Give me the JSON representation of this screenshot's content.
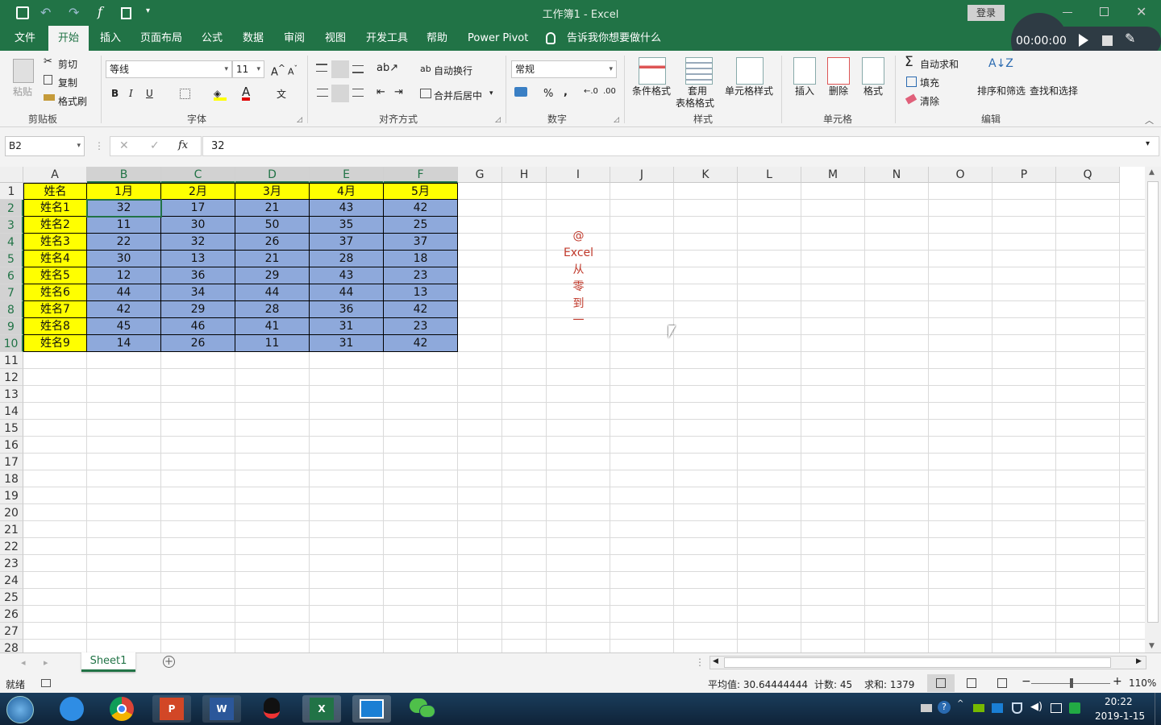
{
  "title": {
    "doc": "工作簿1  -  Excel",
    "login": "登录"
  },
  "tabs": [
    "文件",
    "开始",
    "插入",
    "页面布局",
    "公式",
    "数据",
    "审阅",
    "视图",
    "开发工具",
    "帮助",
    "Power Pivot"
  ],
  "tell_me": "告诉我你想要做什么",
  "recorder": {
    "time": "00:00:00"
  },
  "ribbon": {
    "clipboard": {
      "paste": "粘贴",
      "cut": "剪切",
      "copy": "复制",
      "painter": "格式刷",
      "label": "剪贴板"
    },
    "font": {
      "name": "等线",
      "size": "11",
      "label": "字体",
      "bold": "B",
      "italic": "I",
      "underline": "U"
    },
    "align": {
      "wrap": "自动换行",
      "merge": "合并后居中",
      "label": "对齐方式"
    },
    "number": {
      "format": "常规",
      "label": "数字",
      "percent": "%",
      "comma": ","
    },
    "styles": {
      "cond": "条件格式",
      "table1": "套用",
      "table2": "表格格式",
      "cell": "单元格样式",
      "label": "样式"
    },
    "cells": {
      "insert": "插入",
      "delete": "删除",
      "format": "格式",
      "label": "单元格"
    },
    "edit": {
      "autosum": "自动求和",
      "fill": "填充",
      "clear": "清除",
      "sort": "排序和筛选",
      "find": "查找和选择",
      "label": "编辑"
    }
  },
  "formula_bar": {
    "namebox": "B2",
    "fx": "fx",
    "value": "32"
  },
  "columns": [
    "A",
    "B",
    "C",
    "D",
    "E",
    "F",
    "G",
    "H",
    "I",
    "J",
    "K",
    "L",
    "M",
    "N",
    "O",
    "P",
    "Q"
  ],
  "rows": [
    "1",
    "2",
    "3",
    "4",
    "5",
    "6",
    "7",
    "8",
    "9",
    "10",
    "11",
    "12",
    "13",
    "14",
    "15",
    "16",
    "17",
    "18",
    "19",
    "20",
    "21",
    "22",
    "23",
    "24",
    "25",
    "26",
    "27",
    "28"
  ],
  "table": {
    "header": [
      "姓名",
      "1月",
      "2月",
      "3月",
      "4月",
      "5月"
    ],
    "names": [
      "姓名1",
      "姓名2",
      "姓名3",
      "姓名4",
      "姓名5",
      "姓名6",
      "姓名7",
      "姓名8",
      "姓名9"
    ],
    "values": [
      [
        "32",
        "17",
        "21",
        "43",
        "42"
      ],
      [
        "11",
        "30",
        "50",
        "35",
        "25"
      ],
      [
        "22",
        "32",
        "26",
        "37",
        "37"
      ],
      [
        "30",
        "13",
        "21",
        "28",
        "18"
      ],
      [
        "12",
        "36",
        "29",
        "43",
        "23"
      ],
      [
        "44",
        "34",
        "44",
        "44",
        "13"
      ],
      [
        "42",
        "29",
        "28",
        "36",
        "42"
      ],
      [
        "45",
        "46",
        "41",
        "31",
        "23"
      ],
      [
        "14",
        "26",
        "11",
        "31",
        "42"
      ]
    ]
  },
  "watermark": [
    "@",
    "Excel",
    "从",
    "零",
    "到",
    "一"
  ],
  "sheet_tab": "Sheet1",
  "status": {
    "ready": "就绪",
    "avg": "平均值: 30.64444444",
    "count": "计数: 45",
    "sum": "求和: 1379",
    "zoom": "110%"
  },
  "clock": {
    "time": "20:22",
    "date": "2019-1-15"
  },
  "colors": {
    "excel_green": "#217346",
    "header_yellow": "#ffff00",
    "data_blue": "#8ea9db",
    "watermark_red": "#c0392b"
  }
}
